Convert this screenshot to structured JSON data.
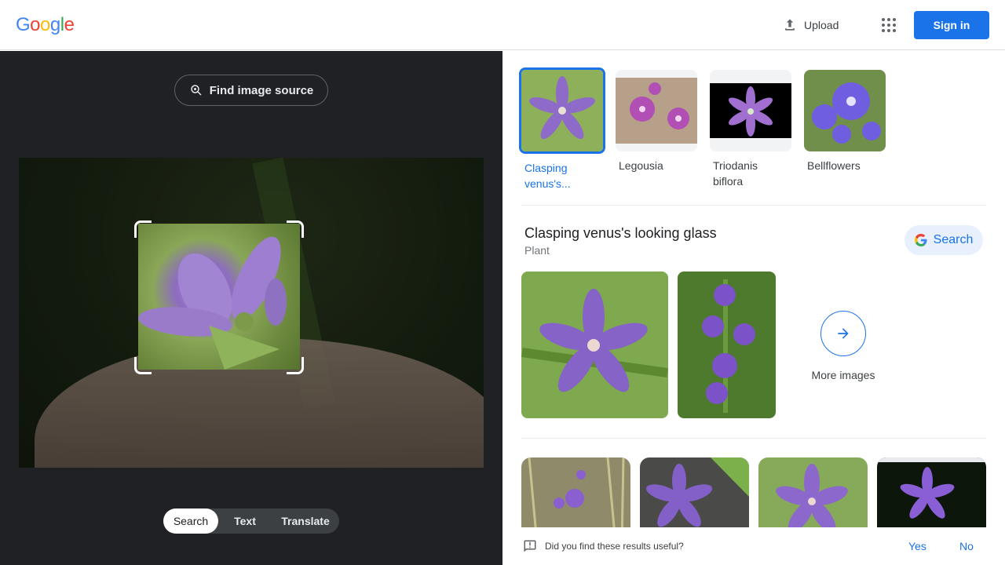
{
  "header": {
    "logo": [
      "G",
      "o",
      "o",
      "g",
      "l",
      "e"
    ],
    "logo_colors": [
      "#4285f4",
      "#ea4335",
      "#fbbc05",
      "#4285f4",
      "#34a853",
      "#ea4335"
    ],
    "upload_label": "Upload",
    "signin_label": "Sign in",
    "accent": "#1a73e8"
  },
  "left": {
    "find_source_label": "Find image source",
    "tabs": [
      {
        "label": "Search",
        "active": true
      },
      {
        "label": "Text",
        "active": false
      },
      {
        "label": "Translate",
        "active": false
      }
    ]
  },
  "chips": [
    {
      "label": "Clasping venus's...",
      "active": true
    },
    {
      "label": "Legousia",
      "active": false
    },
    {
      "label": "Triodanis biflora",
      "active": false
    },
    {
      "label": "Bellflowers",
      "active": false
    }
  ],
  "knowledge_panel": {
    "title": "Clasping venus's looking glass",
    "subtitle": "Plant",
    "search_label": "Search",
    "more_images_label": "More images"
  },
  "feedback": {
    "question": "Did you find these results useful?",
    "yes": "Yes",
    "no": "No"
  }
}
